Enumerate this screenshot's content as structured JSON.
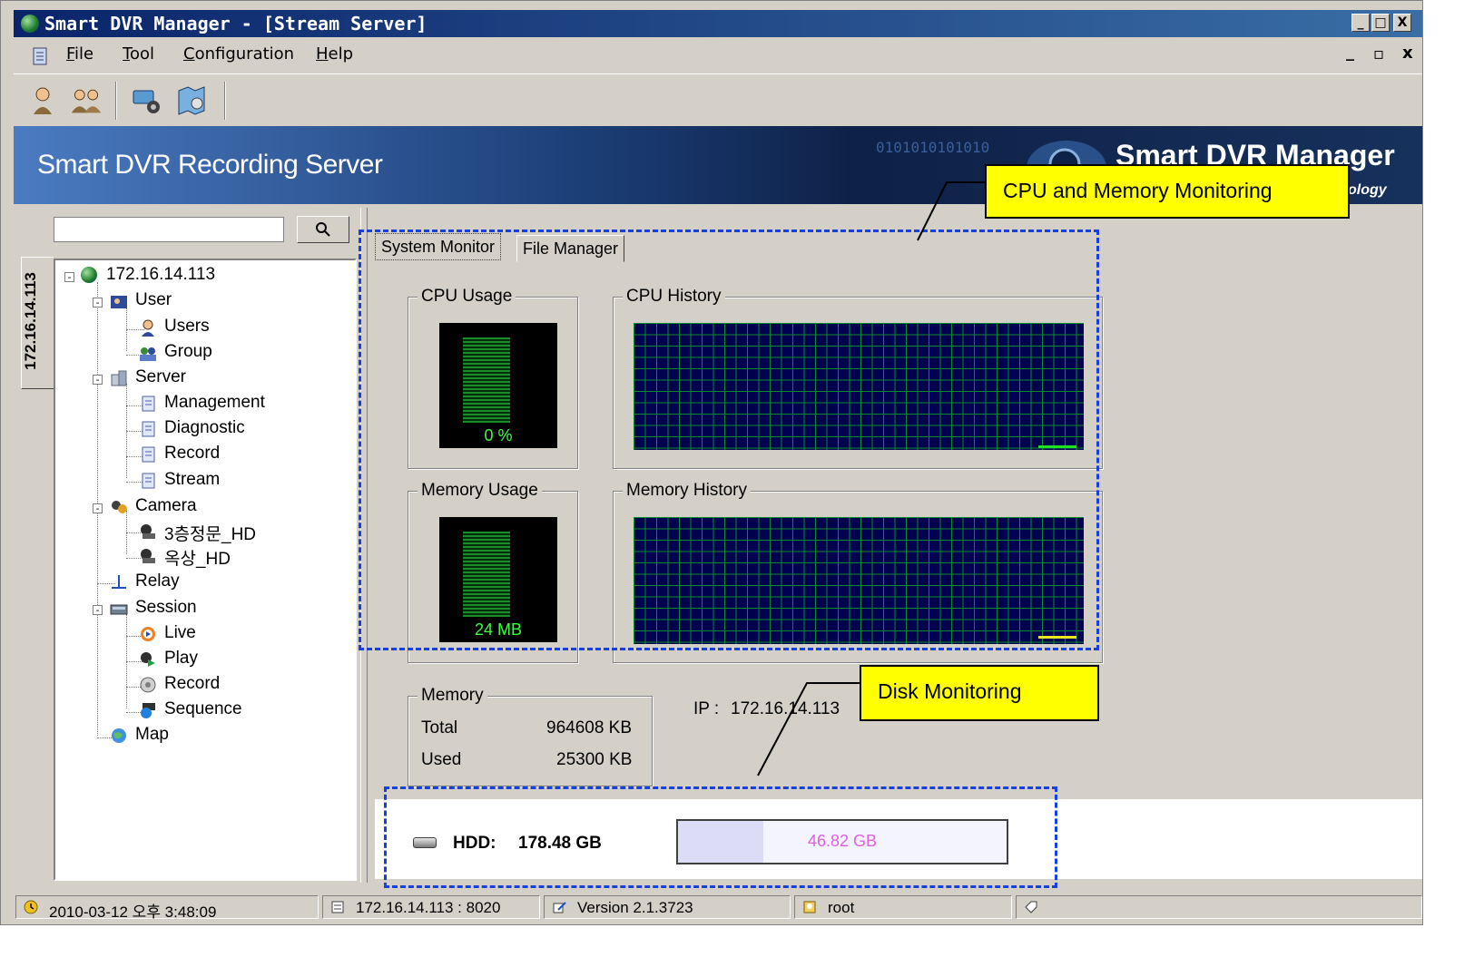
{
  "window": {
    "title": "Smart DVR Manager - [Stream Server]",
    "controls": {
      "minimize": "_",
      "maximize": "□",
      "close": "X"
    },
    "mdi_controls": {
      "minimize": "_",
      "restore": "▫",
      "close": "x"
    }
  },
  "menu": {
    "items": [
      {
        "label": "File"
      },
      {
        "label": "Tool"
      },
      {
        "label": "Configuration"
      },
      {
        "label": "Help"
      }
    ]
  },
  "toolbar": {
    "icons": [
      "user-icon",
      "group-icon",
      "camera-settings-icon",
      "map-icon"
    ]
  },
  "banner": {
    "title": "Smart DVR Recording Server",
    "brand": "Smart DVR Manager",
    "tagline": "ology",
    "binary": "0101010101010"
  },
  "sidebar": {
    "search": {
      "value": "",
      "placeholder": ""
    },
    "search_button_icon": "search-icon",
    "tab_label": "172.16.14.113",
    "tree": {
      "root": "172.16.14.113",
      "user": "User",
      "users": "Users",
      "group": "Group",
      "server": "Server",
      "management": "Management",
      "diagnostic": "Diagnostic",
      "record": "Record",
      "stream": "Stream",
      "camera": "Camera",
      "cam1": "3층정문_HD",
      "cam2": "옥상_HD",
      "relay": "Relay",
      "session": "Session",
      "live": "Live",
      "play": "Play",
      "session_record": "Record",
      "sequence": "Sequence",
      "map": "Map"
    }
  },
  "tabs": [
    {
      "label": "System Monitor",
      "active": true
    },
    {
      "label": "File Manager",
      "active": false
    }
  ],
  "monitor": {
    "cpu_usage": {
      "title": "CPU Usage",
      "value": "0 %",
      "level": 0
    },
    "cpu_history": {
      "title": "CPU History"
    },
    "memory_usage": {
      "title": "Memory Usage",
      "value": "24 MB"
    },
    "memory_history": {
      "title": "Memory History"
    },
    "memory": {
      "title": "Memory",
      "total_label": "Total",
      "total_value": "964608 KB",
      "used_label": "Used",
      "used_value": "25300 KB"
    },
    "ip_label": "IP :",
    "ip_value": "172.16.14.113"
  },
  "disk": {
    "label": "HDD:",
    "size": "178.48 GB",
    "used": "46.82 GB",
    "used_fraction": 0.26
  },
  "annotations": {
    "cpu_memory": "CPU and Memory Monitoring",
    "disk": "Disk Monitoring"
  },
  "statusbar": {
    "datetime": "2010-03-12 오후 3:48:09",
    "server": "172.16.14.113 : 8020",
    "version": "Version 2.1.3723",
    "user": "root"
  },
  "colors": {
    "titlebar": "#0a246a",
    "callout": "#ffff00",
    "annotation_dash": "#1a3fe0",
    "meter_text": "#3cff3c",
    "history_bg": "#000050",
    "history_grid": "#0a8a2a",
    "disk_text": "#e060e0"
  }
}
